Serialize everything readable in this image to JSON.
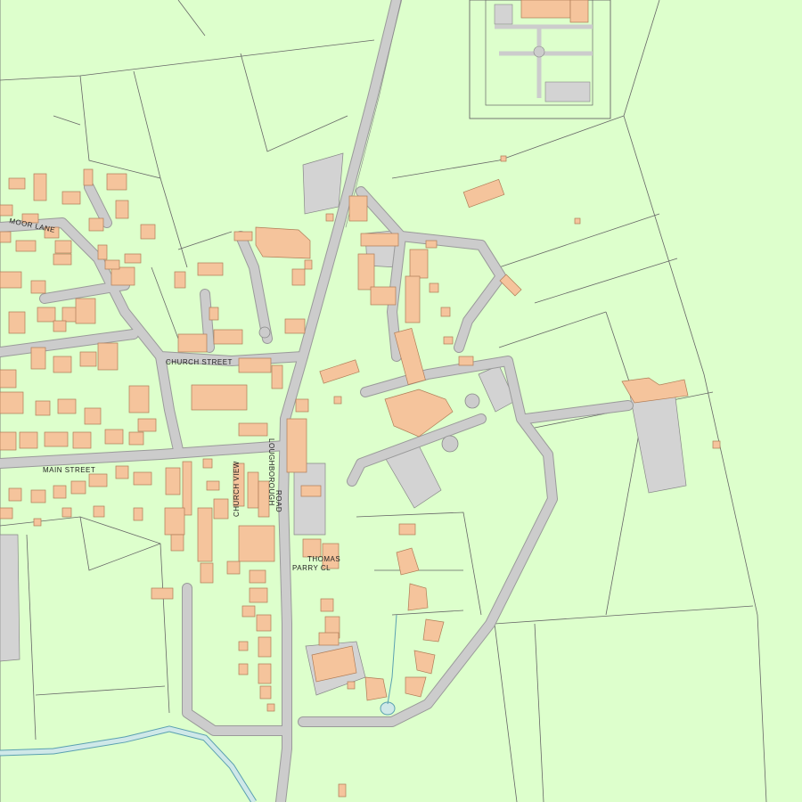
{
  "map": {
    "colors": {
      "land": "#ddffcc",
      "road": "#cccccc",
      "road_edge": "#9a9a9a",
      "building": "#f5c49c",
      "building_edge": "#b07c56",
      "paved": "#d3d3d3",
      "water": "#cfe8e8",
      "water_edge": "#5aa0b0",
      "boundary": "#666666"
    },
    "labels": {
      "moor_lane": "MOOR LANE",
      "church_street": "CHURCH STREET",
      "main_street": "MAIN STREET",
      "church_view": "CHURCH VIEW",
      "loughborough_road_1": "LOUGHBOROUGH",
      "loughborough_road_2": "ROAD",
      "thomas_parry_1": "THOMAS",
      "thomas_parry_2": "PARRY CL"
    }
  }
}
